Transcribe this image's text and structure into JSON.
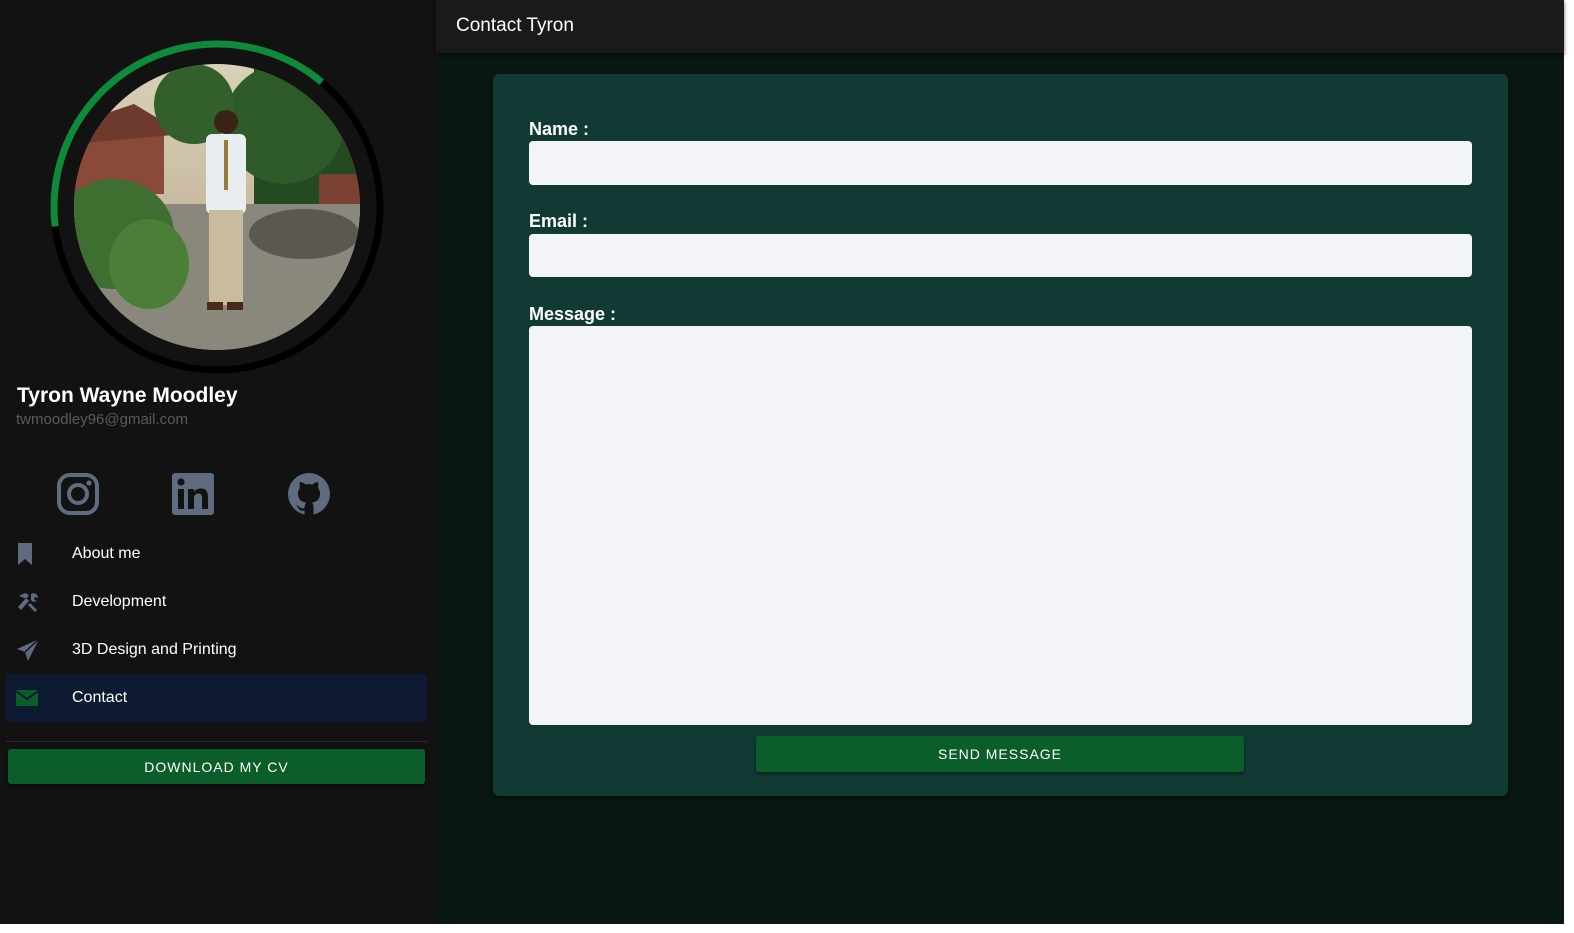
{
  "profile": {
    "name": "Tyron Wayne Moodley",
    "email": "twmoodley96@gmail.com",
    "progress_ring_fraction": 0.38,
    "accent_color": "#0f8a3a"
  },
  "social": [
    {
      "icon": "instagram-icon"
    },
    {
      "icon": "linkedin-icon"
    },
    {
      "icon": "github-icon"
    }
  ],
  "nav": {
    "items": [
      {
        "label": "About me",
        "icon": "bookmark-icon",
        "active": false
      },
      {
        "label": "Development",
        "icon": "tools-icon",
        "active": false
      },
      {
        "label": "3D Design and Printing",
        "icon": "paper-plane-icon",
        "active": false
      },
      {
        "label": "Contact",
        "icon": "envelope-icon",
        "active": true
      }
    ]
  },
  "sidebar": {
    "cv_button_label": "DOWNLOAD MY CV"
  },
  "header": {
    "title": "Contact Tyron"
  },
  "form": {
    "name_label": "Name :",
    "name_value": "",
    "email_label": "Email :",
    "email_value": "",
    "message_label": "Message :",
    "message_value": "",
    "send_label": "SEND MESSAGE"
  },
  "colors": {
    "button_green": "#0b5e2a",
    "card_bg": "#113a35",
    "nav_active_bg": "#0e1a31"
  }
}
